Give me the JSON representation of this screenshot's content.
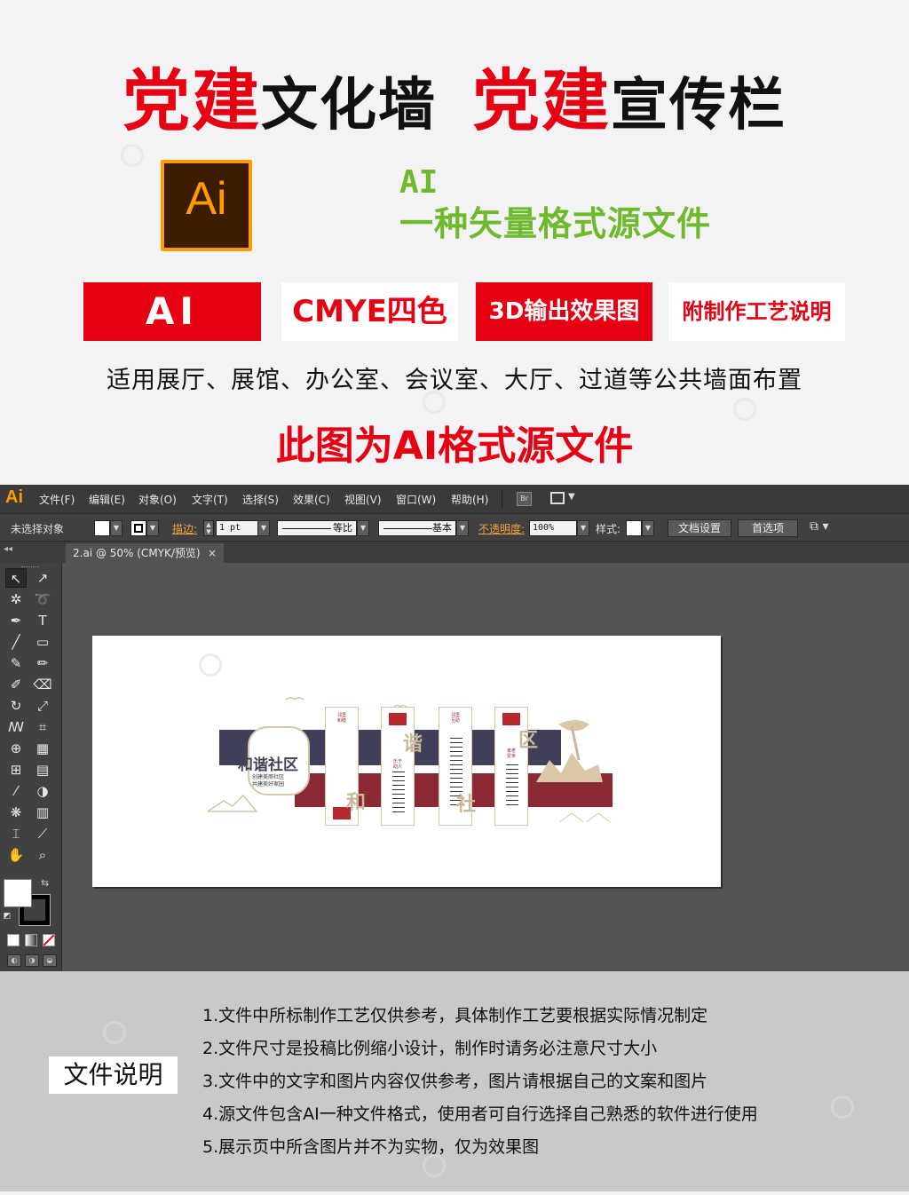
{
  "promo": {
    "headline": [
      {
        "text": "党建",
        "style": "red"
      },
      {
        "text": "文化墙",
        "style": "blk"
      },
      {
        "text": "党建",
        "style": "red"
      },
      {
        "text": "宣传栏",
        "style": "blk"
      }
    ],
    "ai_logo_text": "Ai",
    "ai_desc_line1": "AI",
    "ai_desc_line2": "一种矢量格式源文件",
    "tags": [
      "AI",
      "CMYE四色",
      "3D输出效果图",
      "附制作工艺说明"
    ],
    "usage": "适用展厅、展馆、办公室、会议室、大厅、过道等公共墙面布置",
    "note": "此图为AI格式源文件"
  },
  "app": {
    "logo": "Ai",
    "menu": [
      "文件(F)",
      "编辑(E)",
      "对象(O)",
      "文字(T)",
      "选择(S)",
      "效果(C)",
      "视图(V)",
      "窗口(W)",
      "帮助(H)"
    ],
    "bridge_label": "Br",
    "control": {
      "no_selection": "未选择对象",
      "stroke_label": "描边:",
      "stroke_value": "1 pt",
      "profile1": "等比",
      "profile2": "基本",
      "opacity_label": "不透明度:",
      "opacity_value": "100%",
      "style_label": "样式:",
      "doc_setup": "文档设置",
      "preferences": "首选项"
    },
    "doc_tab": "2.ai @ 50% (CMYK/预览)",
    "doc_tab_close": "×",
    "artwork": {
      "title": "和谐社区",
      "sub1": "创建美丽社区",
      "sub2": "共建美好家园",
      "chars": [
        "谐",
        "和",
        "社",
        "区"
      ],
      "panel_labels": [
        "邻里和睦",
        "乐于助人",
        "邻里互助",
        "孝老爱亲"
      ]
    },
    "colors": {
      "navy": "#3f3f5a",
      "maroon": "#8b2a35",
      "beige": "#d9c7a8",
      "accent_orange": "#ff9a00"
    }
  },
  "info": {
    "label": "文件说明",
    "items": [
      "1.文件中所标制作工艺仅供参考，具体制作工艺要根据实际情况制定",
      "2.文件尺寸是投稿比例缩小设计，制作时请务必注意尺寸大小",
      "3.文件中的文字和图片内容仅供参考，图片请根据自己的文案和图片",
      "4.源文件包含AI一种文件格式，使用者可自行选择自己熟悉的软件进行使用",
      "5.展示页中所含图片并不为实物，仅为效果图"
    ]
  }
}
